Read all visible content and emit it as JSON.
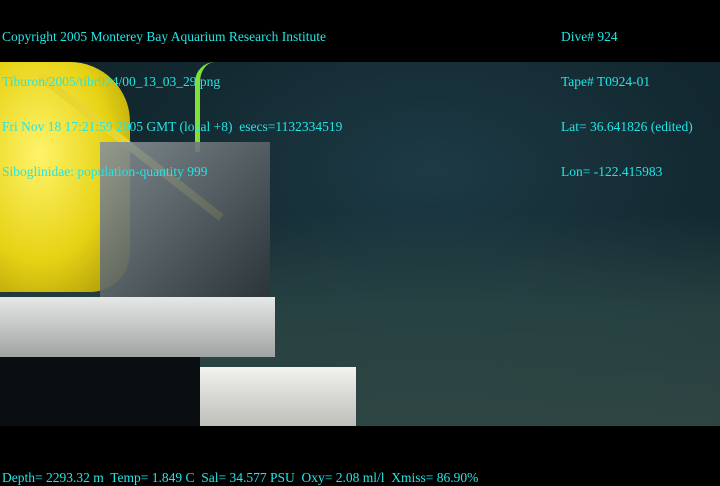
{
  "overlay_left": [
    "Copyright 2005 Monterey Bay Aquarium Research Institute",
    "Tiburon/2005/tibr924/00_13_03_29.png",
    "Fri Nov 18 17:21:59 2005 GMT (local +8)  esecs=1132334519",
    "Siboglinidae: population-quantity 999"
  ],
  "overlay_right": [
    "Dive# 924",
    "Tape# T0924-01",
    "Lat= 36.641826 (edited)",
    "Lon= -122.415983"
  ],
  "sensor_line": "Depth= 2293.32 m  Temp= 1.849 C  Sal= 34.577 PSU  Oxy= 2.08 ml/l  Xmiss= 86.90%",
  "colors": {
    "overlay_text": "#22e6e6",
    "equipment_yellow": "#f2e21a",
    "water": "#142b33"
  }
}
